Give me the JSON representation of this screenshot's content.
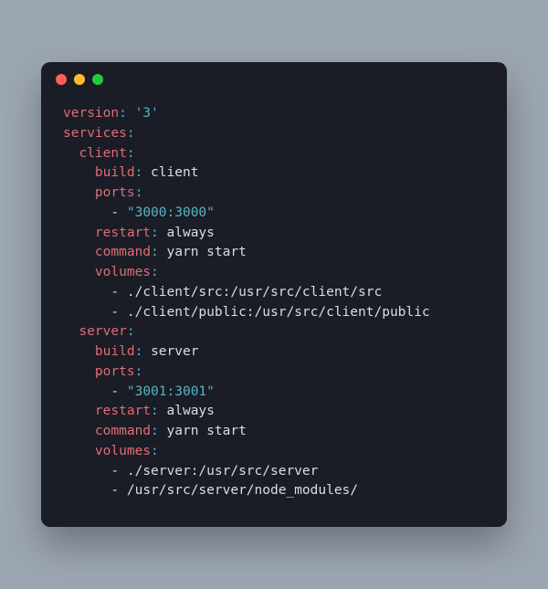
{
  "yaml": {
    "version_key": "version",
    "version_val": "'3'",
    "services_key": "services",
    "client": {
      "name": "client",
      "build_key": "build",
      "build_val": "client",
      "ports_key": "ports",
      "ports_val": "\"3000:3000\"",
      "restart_key": "restart",
      "restart_val": "always",
      "command_key": "command",
      "command_val": "yarn start",
      "volumes_key": "volumes",
      "vol1": "./client/src:/usr/src/client/src",
      "vol2": "./client/public:/usr/src/client/public"
    },
    "server": {
      "name": "server",
      "build_key": "build",
      "build_val": "server",
      "ports_key": "ports",
      "ports_val": "\"3001:3001\"",
      "restart_key": "restart",
      "restart_val": "always",
      "command_key": "command",
      "command_val": "yarn start",
      "volumes_key": "volumes",
      "vol1": "./server:/usr/src/server",
      "vol2": "/usr/src/server/node_modules/"
    }
  }
}
